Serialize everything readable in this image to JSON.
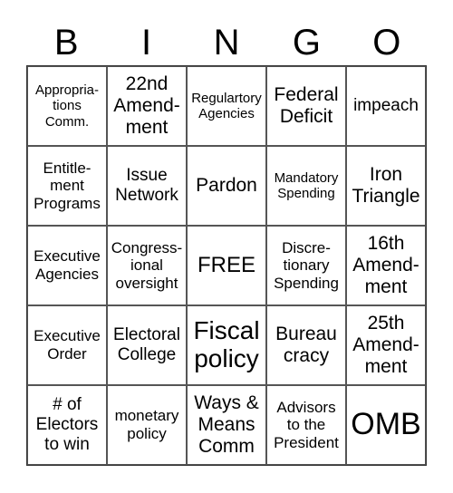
{
  "header": {
    "letters": [
      "B",
      "I",
      "N",
      "G",
      "O"
    ]
  },
  "cells": [
    "Appropria-\ntions\nComm.",
    "22nd\nAmend-\nment",
    "Regulartory\nAgencies",
    "Federal\nDeficit",
    "impeach",
    "Entitle-\nment\nPrograms",
    "Issue\nNetwork",
    "Pardon",
    "Mandatory\nSpending",
    "Iron\nTriangle",
    "Executive\nAgencies",
    "Congress-\nional\noversight",
    "FREE",
    "Discre-\ntionary\nSpending",
    "16th\nAmend-\nment",
    "Executive\nOrder",
    "Electoral\nCollege",
    "Fiscal\npolicy",
    "Bureau\ncracy",
    "25th\nAmend-\nment",
    "# of\nElectors\nto win",
    "monetary\npolicy",
    "Ways &\nMeans\nComm",
    "Advisors\nto the\nPresident",
    "OMB"
  ]
}
